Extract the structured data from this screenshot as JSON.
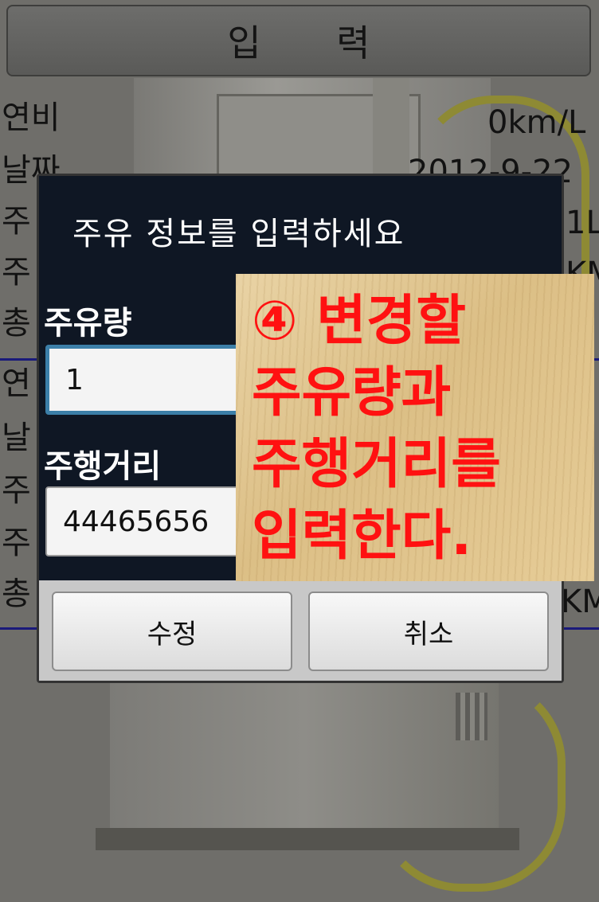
{
  "header": {
    "title": "입 력"
  },
  "background_rows": {
    "block1": [
      {
        "label": "연비",
        "value": "0km/L"
      },
      {
        "label": "날짜",
        "value": "2012-9-22"
      },
      {
        "label": "주",
        "value": "1L"
      },
      {
        "label": "주",
        "value": "KM"
      },
      {
        "label": "총",
        "value": ""
      }
    ],
    "block2": [
      {
        "label": "연",
        "value": ""
      },
      {
        "label": "날",
        "value": ""
      },
      {
        "label": "주",
        "value": ""
      },
      {
        "label": "주",
        "value": ""
      },
      {
        "label": "총",
        "value": "KM"
      }
    ]
  },
  "dialog": {
    "title": "주유 정보를 입력하세요",
    "fuel_label": "주유량",
    "fuel_value": "1",
    "distance_label": "주행거리",
    "distance_value": "44465656",
    "confirm_label": "수정",
    "cancel_label": "취소"
  },
  "annotation": {
    "lines": [
      "④ 변경할",
      "주유량과",
      "주행거리를",
      "입력한다."
    ],
    "color": "#ff1111"
  }
}
